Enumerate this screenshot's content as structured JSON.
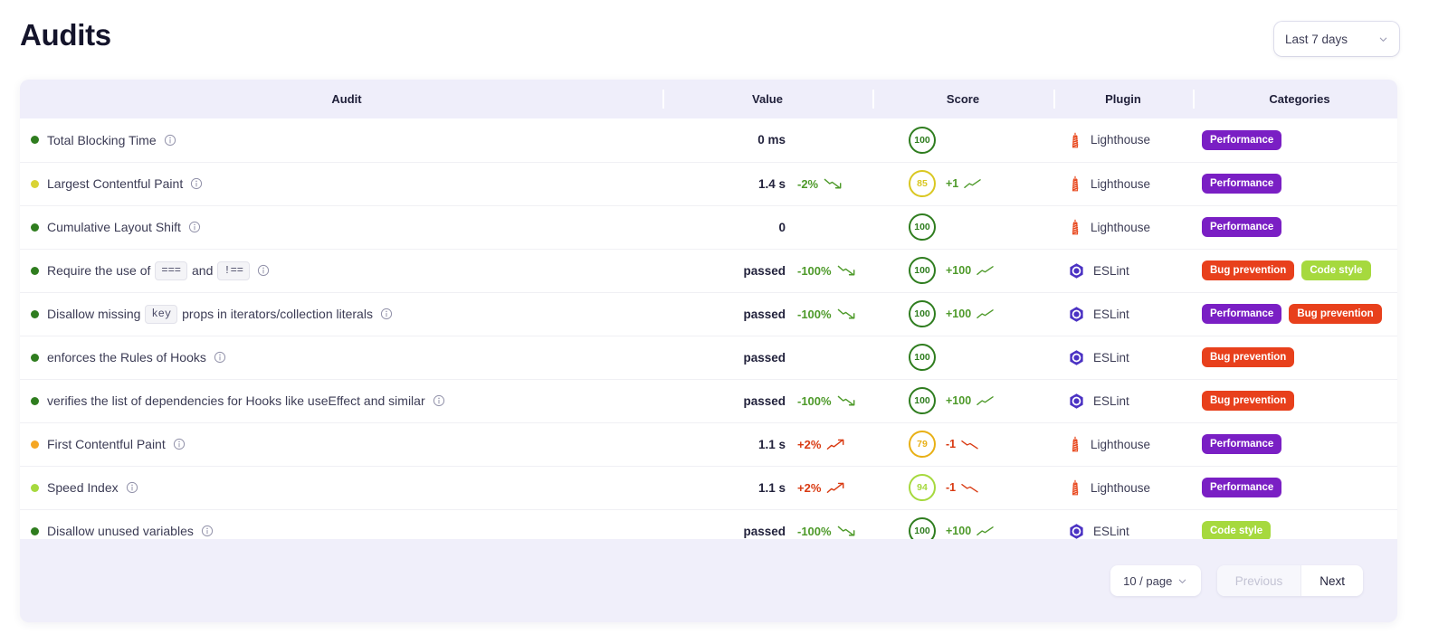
{
  "header": {
    "title": "Audits",
    "period_selector": {
      "value": "Last 7 days",
      "icon": "chevron-down-icon"
    }
  },
  "table": {
    "columns": [
      {
        "key": "audit",
        "label": "Audit"
      },
      {
        "key": "value",
        "label": "Value"
      },
      {
        "key": "score",
        "label": "Score"
      },
      {
        "key": "plugin",
        "label": "Plugin"
      },
      {
        "key": "categories",
        "label": "Categories"
      }
    ],
    "rows": [
      {
        "status_color": "#2f7d1f",
        "name": "Total Blocking Time",
        "name_parts": [
          {
            "type": "text",
            "text": "Total Blocking Time"
          }
        ],
        "info_icon": "info-icon",
        "value": "0 ms",
        "value_delta": "",
        "value_delta_dir": "",
        "score": "100",
        "score_color": "#2f7d1f",
        "score_delta": "",
        "score_delta_dir": "",
        "plugin": "Lighthouse",
        "plugin_icon": "lighthouse-icon",
        "categories": [
          {
            "label": "Performance",
            "color": "#7a1fc4"
          }
        ]
      },
      {
        "status_color": "#d9d335",
        "name": "Largest Contentful Paint",
        "name_parts": [
          {
            "type": "text",
            "text": "Largest Contentful Paint"
          }
        ],
        "info_icon": "info-icon",
        "value": "1.4 s",
        "value_delta": "-2%",
        "value_delta_dir": "down",
        "score": "85",
        "score_color": "#d9c722",
        "score_delta": "+1",
        "score_delta_dir": "up",
        "plugin": "Lighthouse",
        "plugin_icon": "lighthouse-icon",
        "categories": [
          {
            "label": "Performance",
            "color": "#7a1fc4"
          }
        ]
      },
      {
        "status_color": "#2f7d1f",
        "name": "Cumulative Layout Shift",
        "name_parts": [
          {
            "type": "text",
            "text": "Cumulative Layout Shift"
          }
        ],
        "info_icon": "info-icon",
        "value": "0",
        "value_delta": "",
        "value_delta_dir": "",
        "score": "100",
        "score_color": "#2f7d1f",
        "score_delta": "",
        "score_delta_dir": "",
        "plugin": "Lighthouse",
        "plugin_icon": "lighthouse-icon",
        "categories": [
          {
            "label": "Performance",
            "color": "#7a1fc4"
          }
        ]
      },
      {
        "status_color": "#2f7d1f",
        "name": "Require the use of === and !==",
        "name_parts": [
          {
            "type": "text",
            "text": "Require the use of"
          },
          {
            "type": "code",
            "text": "==="
          },
          {
            "type": "text",
            "text": "and"
          },
          {
            "type": "code",
            "text": "!=="
          }
        ],
        "info_icon": "info-icon",
        "value": "passed",
        "value_delta": "-100%",
        "value_delta_dir": "down",
        "score": "100",
        "score_color": "#2f7d1f",
        "score_delta": "+100",
        "score_delta_dir": "up",
        "plugin": "ESLint",
        "plugin_icon": "eslint-icon",
        "categories": [
          {
            "label": "Bug prevention",
            "color": "#e8401c"
          },
          {
            "label": "Code style",
            "color": "#a6d93e"
          }
        ]
      },
      {
        "status_color": "#2f7d1f",
        "name": "Disallow missing key props in iterators/collection literals",
        "name_parts": [
          {
            "type": "text",
            "text": "Disallow missing"
          },
          {
            "type": "code",
            "text": "key"
          },
          {
            "type": "text",
            "text": "props in iterators/collection literals"
          }
        ],
        "info_icon": "info-icon",
        "value": "passed",
        "value_delta": "-100%",
        "value_delta_dir": "down",
        "score": "100",
        "score_color": "#2f7d1f",
        "score_delta": "+100",
        "score_delta_dir": "up",
        "plugin": "ESLint",
        "plugin_icon": "eslint-icon",
        "categories": [
          {
            "label": "Performance",
            "color": "#7a1fc4"
          },
          {
            "label": "Bug prevention",
            "color": "#e8401c"
          }
        ]
      },
      {
        "status_color": "#2f7d1f",
        "name": "enforces the Rules of Hooks",
        "name_parts": [
          {
            "type": "text",
            "text": "enforces the Rules of Hooks"
          }
        ],
        "info_icon": "info-icon",
        "value": "passed",
        "value_delta": "",
        "value_delta_dir": "",
        "score": "100",
        "score_color": "#2f7d1f",
        "score_delta": "",
        "score_delta_dir": "",
        "plugin": "ESLint",
        "plugin_icon": "eslint-icon",
        "categories": [
          {
            "label": "Bug prevention",
            "color": "#e8401c"
          }
        ]
      },
      {
        "status_color": "#2f7d1f",
        "name": "verifies the list of dependencies for Hooks like useEffect and similar",
        "name_parts": [
          {
            "type": "text",
            "text": "verifies the list of dependencies for Hooks like useEffect and similar"
          }
        ],
        "info_icon": "info-icon",
        "value": "passed",
        "value_delta": "-100%",
        "value_delta_dir": "down",
        "score": "100",
        "score_color": "#2f7d1f",
        "score_delta": "+100",
        "score_delta_dir": "up",
        "plugin": "ESLint",
        "plugin_icon": "eslint-icon",
        "categories": [
          {
            "label": "Bug prevention",
            "color": "#e8401c"
          }
        ]
      },
      {
        "status_color": "#f5a623",
        "name": "First Contentful Paint",
        "name_parts": [
          {
            "type": "text",
            "text": "First Contentful Paint"
          }
        ],
        "info_icon": "info-icon",
        "value": "1.1 s",
        "value_delta": "+2%",
        "value_delta_dir": "up",
        "score": "79",
        "score_color": "#e8b016",
        "score_delta": "-1",
        "score_delta_dir": "down",
        "plugin": "Lighthouse",
        "plugin_icon": "lighthouse-icon",
        "categories": [
          {
            "label": "Performance",
            "color": "#7a1fc4"
          }
        ]
      },
      {
        "status_color": "#a6d93e",
        "name": "Speed Index",
        "name_parts": [
          {
            "type": "text",
            "text": "Speed Index"
          }
        ],
        "info_icon": "info-icon",
        "value": "1.1 s",
        "value_delta": "+2%",
        "value_delta_dir": "up",
        "score": "94",
        "score_color": "#a6d93e",
        "score_delta": "-1",
        "score_delta_dir": "down",
        "plugin": "Lighthouse",
        "plugin_icon": "lighthouse-icon",
        "categories": [
          {
            "label": "Performance",
            "color": "#7a1fc4"
          }
        ]
      },
      {
        "status_color": "#2f7d1f",
        "name": "Disallow unused variables",
        "name_parts": [
          {
            "type": "text",
            "text": "Disallow unused variables"
          }
        ],
        "info_icon": "info-icon",
        "value": "passed",
        "value_delta": "-100%",
        "value_delta_dir": "down",
        "score": "100",
        "score_color": "#2f7d1f",
        "score_delta": "+100",
        "score_delta_dir": "up",
        "plugin": "ESLint",
        "plugin_icon": "eslint-icon",
        "categories": [
          {
            "label": "Code style",
            "color": "#a6d93e"
          }
        ]
      }
    ]
  },
  "pagination": {
    "per_page": "10 / page",
    "per_page_icon": "chevron-down-icon",
    "previous_label": "Previous",
    "next_label": "Next",
    "previous_disabled": true
  },
  "colors": {
    "badge_performance": "#7a1fc4",
    "badge_bug_prevention": "#e8401c",
    "badge_code_style": "#a6d93e",
    "positive_green": "#4e9a2a",
    "negative_red": "#d93a12",
    "card_bg": "#f3f2fb",
    "header_bg": "#efeefa"
  }
}
